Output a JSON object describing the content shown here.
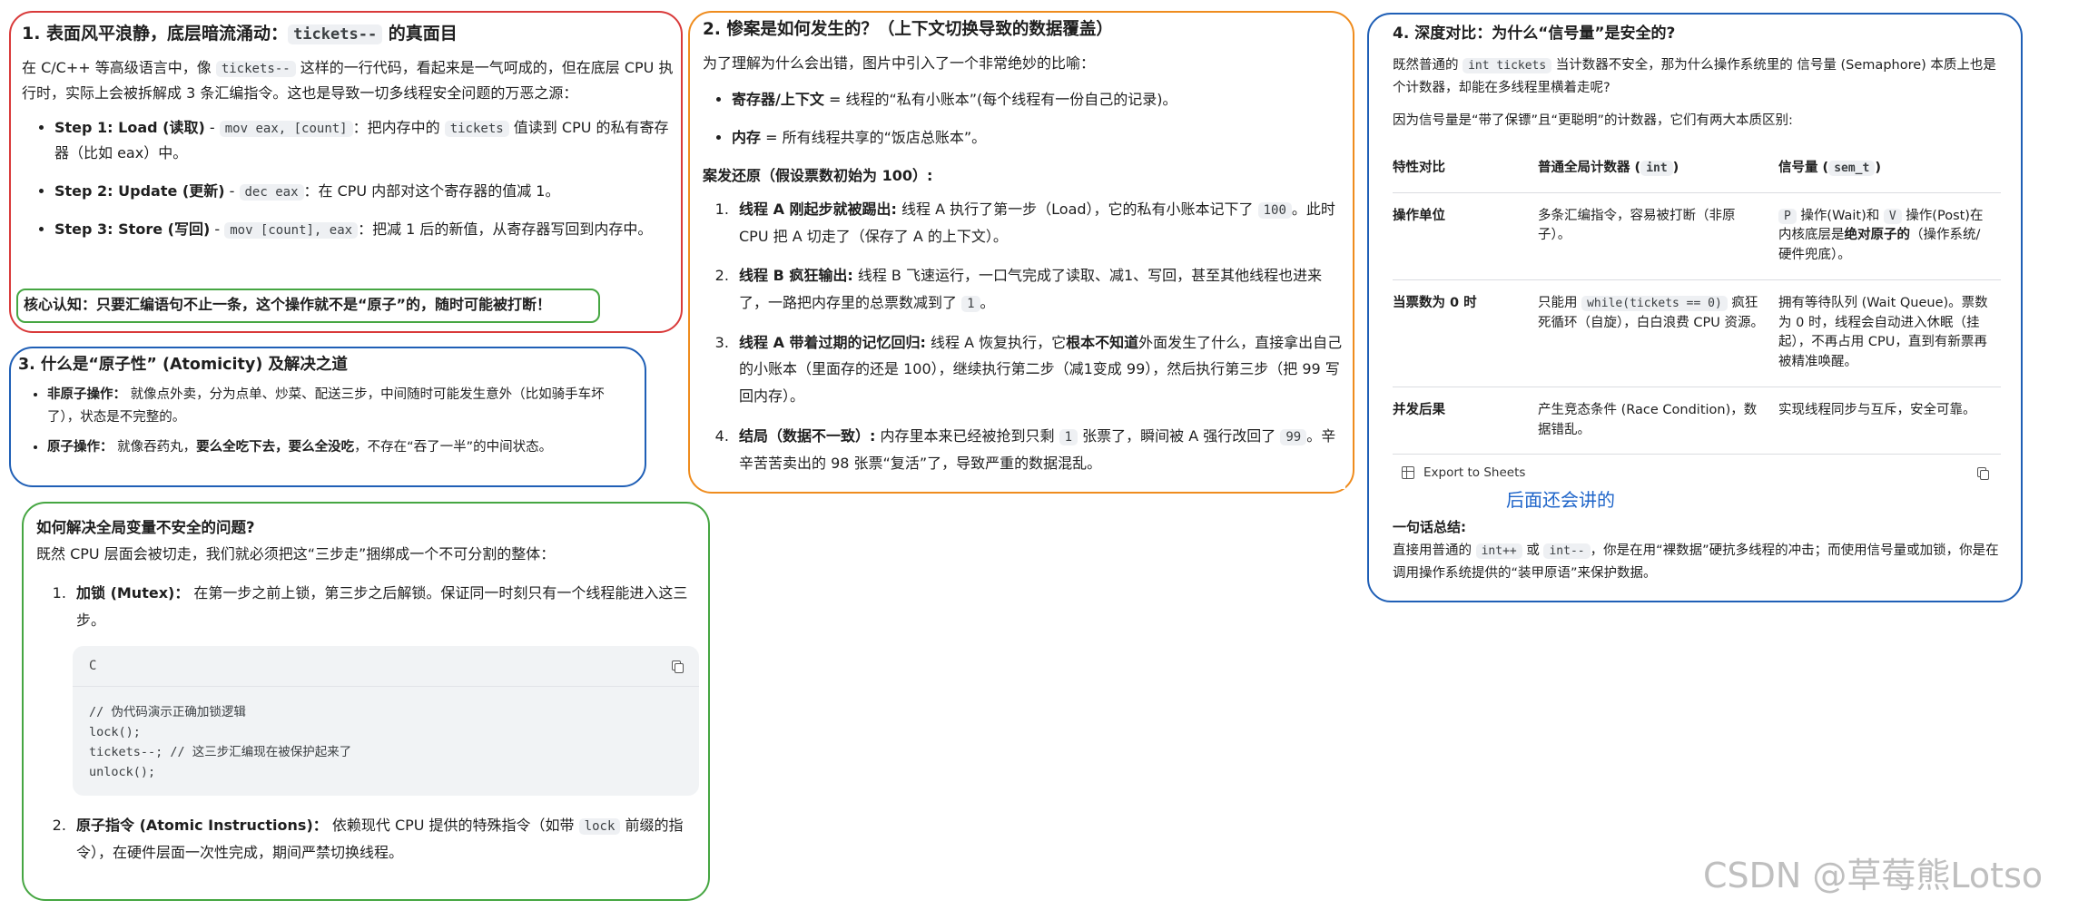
{
  "colors": {
    "red": "#d93a3a",
    "blue": "#1f5fb6",
    "green": "#46a642",
    "orange": "#ef8c1e",
    "handwriting": "#1f65c9",
    "watermark": "#bfbfbf"
  },
  "panel1": {
    "title_pre": "1. 表面风平浪静，底层暗流涌动：",
    "title_code": "tickets--",
    "title_post": " 的真面目",
    "intro_1": "在 C/C++ 等高级语言中，像 ",
    "intro_code": "tickets--",
    "intro_2": " 这样的一行代码，看起来是一气呵成的，但在底层 CPU 执行时，实际上会被拆解成 3 条汇编指令。这也是导致一切多线程安全问题的万恶之源：",
    "steps": [
      {
        "title": "Step 1: Load (读取)",
        "sep": " - ",
        "code": "mov eax, [count]",
        "text1": "：把内存中的 ",
        "code2": "tickets",
        "text2": " 值读到 CPU 的私有寄存器（比如 eax）中。"
      },
      {
        "title": "Step 2: Update (更新)",
        "sep": " - ",
        "code": "dec eax",
        "text1": "：在 CPU 内部对这个寄存器的值减 1。",
        "code2": "",
        "text2": ""
      },
      {
        "title": "Step 3: Store (写回)",
        "sep": " - ",
        "code": "mov [count], eax",
        "text1": "：把减 1 后的新值，从寄存器写回到内存中。",
        "code2": "",
        "text2": ""
      }
    ],
    "core": "核心认知：只要汇编语句不止一条，这个操作就不是“原子”的，随时可能被打断！"
  },
  "panel3": {
    "title": "3. 什么是“原子性” (Atomicity) 及解决之道",
    "items": [
      {
        "label": "非原子操作：",
        "text": " 就像点外卖，分为点单、炒菜、配送三步，中间随时可能发生意外（比如骑手车坏了），状态是不完整的。"
      },
      {
        "label": "原子操作：",
        "text": " 就像吞药丸，",
        "bold": "要么全吃下去，要么全没吃",
        "tail": "，不存在“吞了一半”的中间状态。"
      }
    ]
  },
  "panel5": {
    "title": "如何解决全局变量不安全的问题?",
    "intro": "既然 CPU 层面会被切走，我们就必须把这“三步走”捆绑成一个不可分割的整体：",
    "item1_label": "加锁 (Mutex)：",
    "item1_text": " 在第一步之前上锁，第三步之后解锁。保证同一时刻只有一个线程能进入这三步。",
    "code_lang": "C",
    "code_lines": "// 伪代码演示正确加锁逻辑\nlock();\ntickets--; // 这三步汇编现在被保护起来了\nunlock();",
    "item2_label": "原子指令 (Atomic Instructions)：",
    "item2_text1": " 依赖现代 CPU 提供的特殊指令（如带 ",
    "item2_code": "lock",
    "item2_text2": " 前缀的指令），在硬件层面一次性完成，期间严禁切换线程。"
  },
  "panel2": {
    "title": "2. 惨案是如何发生的？（上下文切换导致的数据覆盖）",
    "intro": "为了理解为什么会出错，图片中引入了一个非常绝妙的比喻：",
    "defs": [
      {
        "label": "寄存器/上下文",
        "text": " = 线程的“私有小账本”(每个线程有一份自己的记录)。"
      },
      {
        "label": "内存",
        "text": " = 所有线程共享的“饭店总账本”。"
      }
    ],
    "case_title": "案发还原（假设票数初始为 100）:",
    "steps": [
      {
        "label": "线程 A 刚起步就被踢出:",
        "t1": " 线程 A 执行了第一步（Load），它的私有小账本记下了 ",
        "code": "100",
        "t2": "。此时 CPU 把 A 切走了（保存了 A 的上下文）。"
      },
      {
        "label": "线程 B 疯狂输出:",
        "t1": " 线程 B 飞速运行，一口气完成了读取、减1、写回，甚至其他线程也进来了，一路把内存里的总票数减到了 ",
        "code": "1",
        "t2": "。"
      },
      {
        "label": "线程 A 带着过期的记忆回归:",
        "t1": " 线程 A 恢复执行，它",
        "bold": "根本不知道",
        "t1b": "外面发生了什么，直接拿出自己的小账本（里面存的还是 100），继续执行第二步（减1变成 99），然后执行第三步（把 99 写回内存）。",
        "code": "",
        "t2": ""
      },
      {
        "label": "结局（数据不一致）:",
        "t1": " 内存里本来已经被抢到只剩 ",
        "code": "1",
        "t2": " 张票了，瞬间被 A 强行改回了 ",
        "code2": "99",
        "t3": "。辛辛苦苦卖出的 98 张票“复活”了，导致严重的数据混乱。"
      }
    ]
  },
  "panel4": {
    "title": "4. 深度对比：为什么“信号量”是安全的?",
    "intro_1": "既然普通的 ",
    "intro_code": "int tickets",
    "intro_2": " 当计数器不安全，那为什么操作系统里的 信号量 (Semaphore) 本质上也是个计数器，却能在多线程里横着走呢?",
    "intro2": "因为信号量是“带了保镖”且“更聪明”的计数器，它们有两大本质区别:",
    "headers": {
      "c1": "特性对比",
      "c2_pre": "普通全局计数器 (",
      "c2_code": "int",
      "c2_post": ")",
      "c3_pre": "信号量 (",
      "c3_code": "sem_t",
      "c3_post": ")"
    },
    "rows": [
      {
        "k": "操作单位",
        "a": "多条汇编指令，容易被打断（非原子）。",
        "b_code1": "P",
        "b_1": " 操作(Wait)和 ",
        "b_code2": "V",
        "b_2": " 操作(Post)在内核底层是",
        "b_bold": "绝对原子的",
        "b_3": "（操作系统/硬件兜底）。"
      },
      {
        "k": "当票数为 0 时",
        "a_pre": "只能用 ",
        "a_code": "while(tickets == 0)",
        "a_post": " 疯狂死循环（自旋），白白浪费 CPU 资源。",
        "b": "拥有等待队列 (Wait Queue)。票数为 0 时，线程会自动进入休眠（挂起），不再占用 CPU，直到有新票再被精准唤醒。"
      },
      {
        "k": "并发后果",
        "a": "产生竞态条件 (Race Condition)，数据错乱。",
        "b": "实现线程同步与互斥，安全可靠。"
      }
    ],
    "export_label": "Export to Sheets",
    "handwritten": "后面还会讲的",
    "summary_title": "一句话总结:",
    "sum_1": "直接用普通的 ",
    "sum_code1": "int++",
    "sum_2": " 或 ",
    "sum_code2": "int--",
    "sum_3": "，你是在用“裸数据”硬抗多线程的冲击；而使用信号量或加锁，你是在调用操作系统提供的“装甲原语”来保护数据。"
  },
  "watermark": "CSDN @草莓熊Lotso"
}
